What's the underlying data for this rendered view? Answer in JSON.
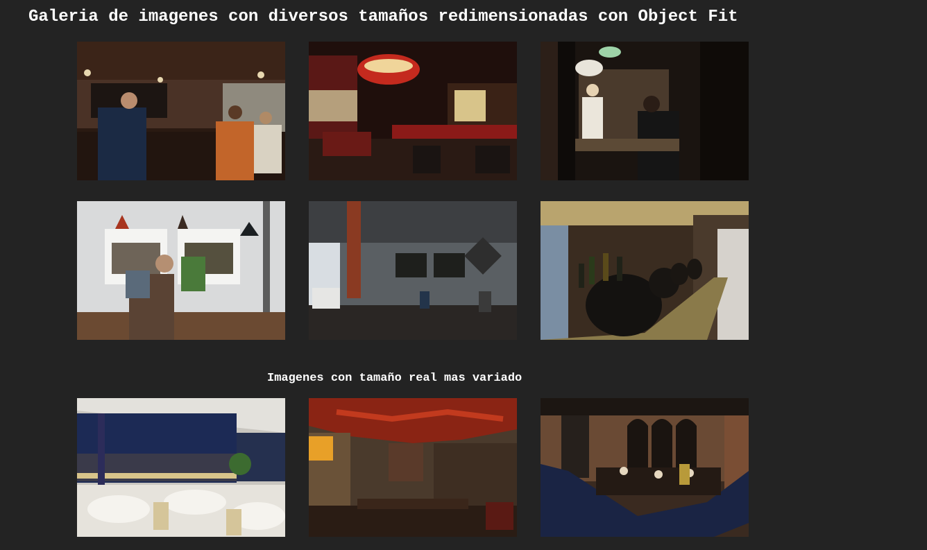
{
  "page": {
    "title": "Galeria de imagenes con diversos tamaños redimensionadas con Object Fit",
    "subtitle": "Imagenes con tamaño real mas variado"
  },
  "gallery_top": [
    {
      "name": "bar-interior-crowd-image"
    },
    {
      "name": "chandelier-lounge-image"
    },
    {
      "name": "counter-chefs-image"
    },
    {
      "name": "cafe-window-diners-image"
    },
    {
      "name": "coffee-shop-image"
    },
    {
      "name": "beer-taps-bar-image"
    }
  ],
  "gallery_bottom": [
    {
      "name": "seaside-dining-hall-image"
    },
    {
      "name": "red-ceiling-restaurant-image"
    },
    {
      "name": "brick-arches-restaurant-image"
    }
  ],
  "colors": {
    "background": "#232323",
    "text": "#ffffff"
  }
}
